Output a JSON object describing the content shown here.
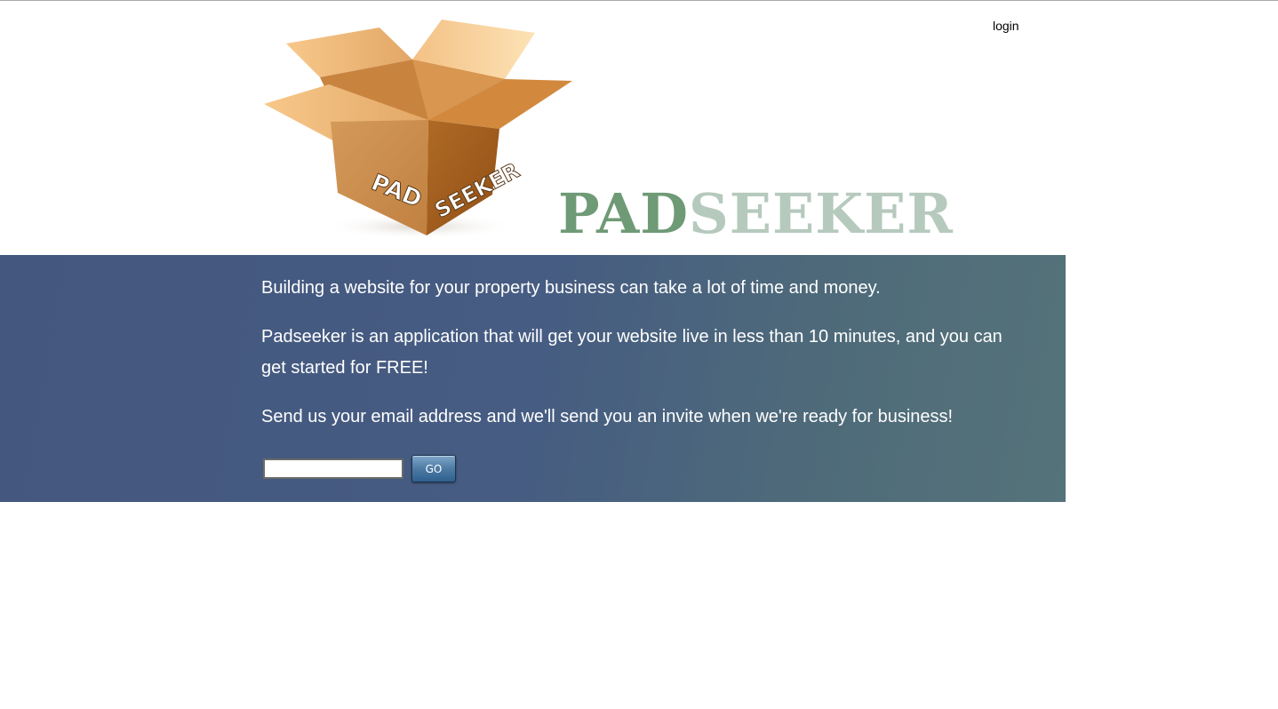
{
  "header": {
    "login_label": "login",
    "box_logo_text": [
      "PAD",
      "SEEKER"
    ],
    "wordmark": {
      "pad": "PAD",
      "seeker": "SEEKER"
    }
  },
  "banner": {
    "paragraphs": [
      "Building a website for your property business can take a lot of time and money.",
      "Padseeker is an application that will get your website live in less than 10 minutes, and you can get started for FREE!",
      "Send us your email address and we'll send you an invite when we're ready for business!"
    ],
    "email_value": "",
    "go_label": "GO"
  },
  "colors": {
    "banner_start": "#44577f",
    "banner_end": "#55737a",
    "wordmark_pad": "#6f9a76",
    "wordmark_seeker": "#b6c9bd",
    "box_main": "#c98a4c"
  }
}
